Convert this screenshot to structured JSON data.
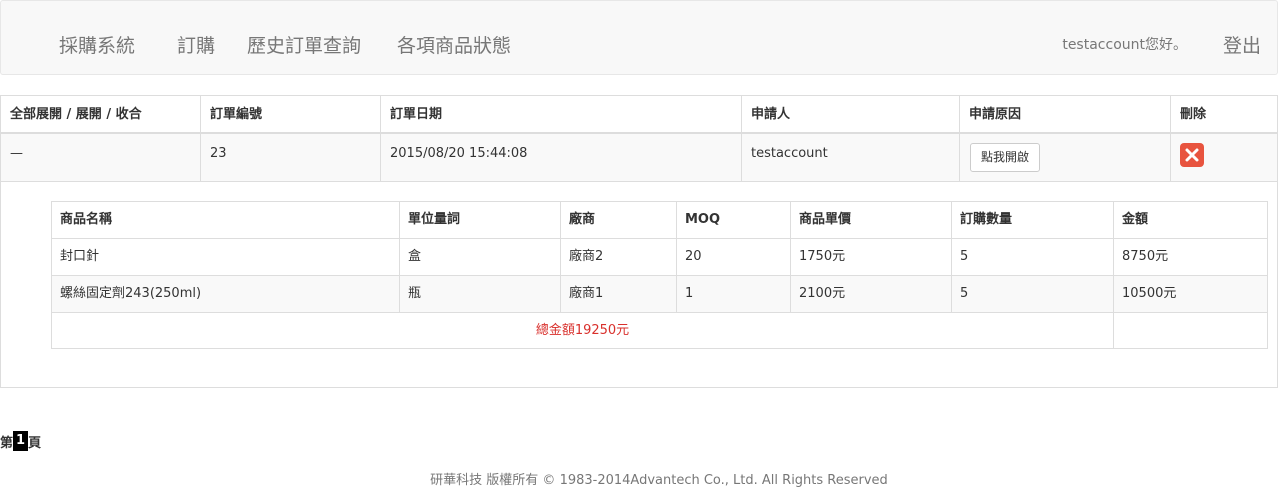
{
  "nav": {
    "brand": "採購系統",
    "links": [
      "訂購",
      "歷史訂單查詢",
      "各項商品狀態"
    ],
    "greeting": "testaccount您好。",
    "logout": "登出"
  },
  "orders": {
    "headers": [
      "全部展開 / 展開 / 收合",
      "訂單編號",
      "訂單日期",
      "申請人",
      "申請原因",
      "刪除"
    ],
    "row": {
      "toggle": "—",
      "order_no": "23",
      "date": "2015/08/20 15:44:08",
      "applicant": "testaccount",
      "reason_button": "點我開啟",
      "delete_icon": "delete-x-icon"
    }
  },
  "details": {
    "headers": [
      "商品名稱",
      "單位量詞",
      "廠商",
      "MOQ",
      "商品單價",
      "訂購數量",
      "金額"
    ],
    "rows": [
      [
        "封口針",
        "盒",
        "廠商2",
        "20",
        "1750元",
        "5",
        "8750元"
      ],
      [
        "螺絲固定劑243(250ml)",
        "瓶",
        "廠商1",
        "1",
        "2100元",
        "5",
        "10500元"
      ]
    ],
    "total": "總金額19250元"
  },
  "pager": {
    "prefix": "第",
    "current": "1",
    "suffix": "頁"
  },
  "footer": "研華科技 版權所有 © 1983-2014Advantech Co., Ltd. All Rights Reserved",
  "colors": {
    "delete": "#e8543f",
    "total": "#d9302c"
  }
}
